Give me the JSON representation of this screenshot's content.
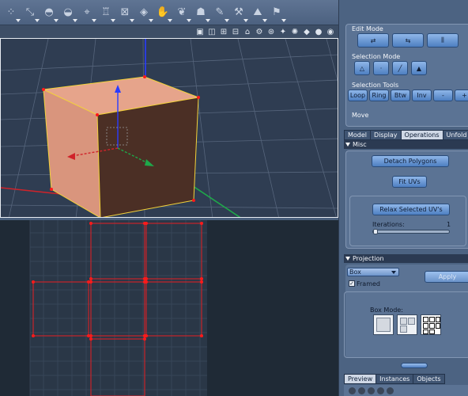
{
  "toolbar": {
    "tools": [
      {
        "icon": "arrow-move-icon",
        "glyph": "⁘"
      },
      {
        "icon": "resize-icon",
        "glyph": "⤡"
      },
      {
        "icon": "dome-icon",
        "glyph": "◓"
      },
      {
        "icon": "camera-icon",
        "glyph": "◒"
      },
      {
        "icon": "lasso-icon",
        "glyph": "⌖"
      },
      {
        "icon": "goblet-icon",
        "glyph": "♖"
      },
      {
        "icon": "crop-icon",
        "glyph": "⊠"
      },
      {
        "icon": "cube-shape-icon",
        "glyph": "◈"
      },
      {
        "icon": "hand-icon",
        "glyph": "✋"
      },
      {
        "icon": "paint-icon",
        "glyph": "❦"
      },
      {
        "icon": "stamp-icon",
        "glyph": "☗"
      },
      {
        "icon": "wrench-icon",
        "glyph": "✎"
      },
      {
        "icon": "brush-icon",
        "glyph": "⚒"
      },
      {
        "icon": "terrain-icon",
        "glyph": "⛰"
      },
      {
        "icon": "flag-icon",
        "glyph": "⚑"
      }
    ]
  },
  "viewport_header": {
    "icons": [
      "layout-single-icon",
      "layout-split-icon",
      "layout-quad-icon",
      "layout-grid-icon",
      "camera-view-icon",
      "gears-icon",
      "orbit-icon",
      "light-icon",
      "sun-icon",
      "cube-display-icon",
      "sphere-icon",
      "smooth-sphere-icon"
    ]
  },
  "panel": {
    "edit_mode": {
      "title": "Edit Mode",
      "icons": [
        "edit-move-icon",
        "edit-flatten-icon",
        "edit-wrap-icon"
      ]
    },
    "selection_mode": {
      "title": "Selection Mode",
      "icons": [
        "select-vertex-icon",
        "select-point-icon",
        "select-edge-icon",
        "select-face-icon"
      ]
    },
    "selection_tools": {
      "title": "Selection Tools",
      "buttons": [
        "Loop",
        "Ring",
        "Btw",
        "Inv",
        "-",
        "+"
      ]
    },
    "current_tool": "Move",
    "tabs": [
      "Model",
      "Display",
      "Operations",
      "Unfold"
    ],
    "active_tab": "Operations",
    "misc": {
      "title": "Misc",
      "detach": "Detach Polygons",
      "fit": "Fit UVs",
      "relax": "Relax Selected UV's",
      "iterations_label": "Iterations:",
      "iterations_value": "1"
    },
    "projection": {
      "title": "Projection",
      "type": "Box",
      "apply": "Apply",
      "framed_label": "Framed",
      "framed_checked": true,
      "box_mode_label": "Box Mode:"
    },
    "bottom_tabs": [
      "Preview",
      "Instances",
      "Objects"
    ],
    "active_bottom_tab": "Preview"
  },
  "colors": {
    "cube_front": "#d9957d",
    "cube_side": "#4b2f25",
    "uv_lines": "#c8232a",
    "selection_vertex": "#ff1a1a",
    "axis_blue": "#2a3cff",
    "axis_green": "#1fa84a",
    "axis_red": "#d0232a"
  }
}
